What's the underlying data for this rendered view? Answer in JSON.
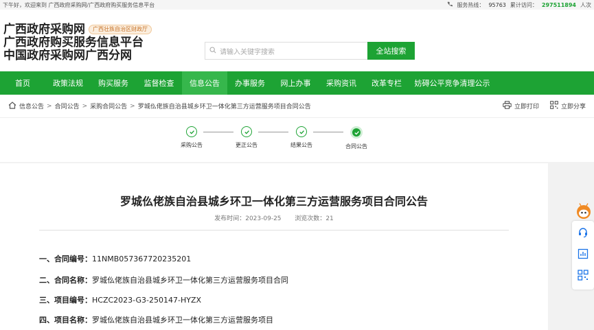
{
  "topbar": {
    "greeting": "下午好，欢迎来到 广西政府采购网/广西政府购买服务信息平台",
    "hotline_label": "服务热线：",
    "hotline": "95763",
    "visit_label": "累计访问：",
    "visit_count": "297511894",
    "visit_unit": "人次"
  },
  "logo": {
    "line1": "广西政府采购网",
    "badge": "广西壮族自治区财政厅",
    "line2": "广西政府购买服务信息平台",
    "line3": "中国政府采购网广西分网"
  },
  "search": {
    "placeholder": "请输入关键字搜索",
    "button": "全站搜索"
  },
  "nav": {
    "items": [
      "首页",
      "政策法规",
      "购买服务",
      "监督检查",
      "信息公告",
      "办事服务",
      "网上办事",
      "采购资讯",
      "改革专栏",
      "妨碍公平竞争清理公示"
    ],
    "active_index": 4
  },
  "breadcrumb": {
    "items": [
      "信息公告",
      "合同公告",
      "采购合同公告",
      "罗城仫佬族自治县城乡环卫一体化第三方运营服务项目合同公告"
    ],
    "print": "立即打印",
    "share": "立即分享"
  },
  "steps": [
    "采购公告",
    "更正公告",
    "结果公告",
    "合同公告"
  ],
  "article": {
    "title": "罗城仫佬族自治县城乡环卫一体化第三方运营服务项目合同公告",
    "publish_label": "发布时间：",
    "publish_date": "2023-09-25",
    "views_label": "浏览次数：",
    "views": "21",
    "fields": [
      {
        "label": "一、合同编号：",
        "value": "11NMB057367720235201"
      },
      {
        "label": "二、合同名称：",
        "value": "罗城仫佬族自治县城乡环卫一体化第三方运营服务项目合同"
      },
      {
        "label": "三、项目编号：",
        "value": "HCZC2023-G3-250147-HYZX"
      },
      {
        "label": "四、项目名称：",
        "value": "罗城仫佬族自治县城乡环卫一体化第三方运营服务项目"
      }
    ]
  },
  "colors": {
    "brand_green": "#1da334",
    "visit_green": "#1da334",
    "mascot_orange": "#f08a24"
  }
}
